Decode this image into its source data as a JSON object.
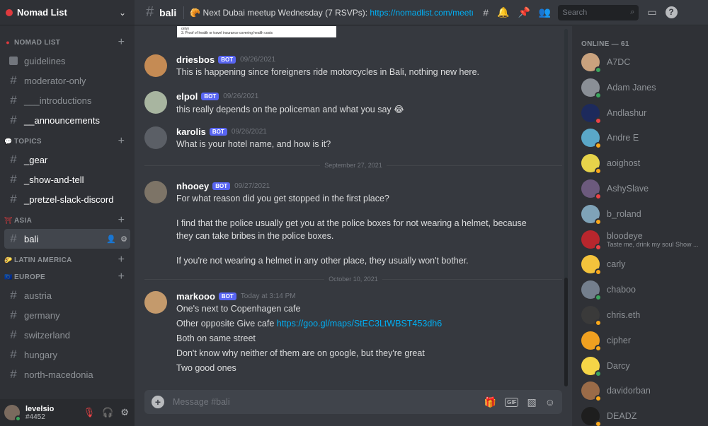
{
  "server": {
    "name": "Nomad List"
  },
  "sidebar": {
    "categories": [
      {
        "label": "NOMAD LIST",
        "channels": [
          {
            "name": "guidelines",
            "kind": "rules"
          },
          {
            "name": "moderator-only",
            "kind": "text"
          },
          {
            "name": "___introductions",
            "kind": "text"
          },
          {
            "name": "__announcements",
            "kind": "text",
            "bold": true
          }
        ]
      },
      {
        "label": "TOPICS",
        "channels": [
          {
            "name": "_gear",
            "kind": "text",
            "bold": true
          },
          {
            "name": "_show-and-tell",
            "kind": "text",
            "bold": true
          },
          {
            "name": "_pretzel-slack-discord",
            "kind": "text",
            "bold": true
          }
        ]
      },
      {
        "label": "ASIA",
        "channels": [
          {
            "name": "bali",
            "kind": "text",
            "active": true
          }
        ]
      },
      {
        "label": "LATIN AMERICA",
        "channels": []
      },
      {
        "label": "EUROPE",
        "channels": [
          {
            "name": "austria",
            "kind": "text"
          },
          {
            "name": "germany",
            "kind": "text"
          },
          {
            "name": "switzerland",
            "kind": "text"
          },
          {
            "name": "hungary",
            "kind": "text"
          },
          {
            "name": "north-macedonia",
            "kind": "text"
          }
        ]
      }
    ]
  },
  "user": {
    "name": "levelsio",
    "tag": "#4452"
  },
  "topbar": {
    "channel": "bali",
    "topic_text": "🥐 Next Dubai meetup Wednesday (7 RSVPs): ",
    "topic_link": "https://nomadlist.com/meetups...",
    "search_placeholder": "Search"
  },
  "preview": {
    "lines": [
      "only)",
      "3. Proof of health or travel insurance  covering health costs"
    ]
  },
  "messages": [
    {
      "author": "driesbos",
      "bot": "BOT",
      "time": "09/26/2021",
      "lines": [
        "This is happening since foreigners ride motorcycles in Bali, nothing new here."
      ]
    },
    {
      "author": "elpol",
      "bot": "BOT",
      "time": "09/26/2021",
      "lines": [
        "this really depends on the policeman and what you say 😂"
      ]
    },
    {
      "author": "karolis",
      "bot": "BOT",
      "time": "09/26/2021",
      "lines": [
        "What is your hotel name, and how is it?"
      ]
    },
    {
      "author": "nhooey",
      "bot": "BOT",
      "time": "09/27/2021",
      "lines": [
        "For what reason did you get stopped in the first place?",
        "",
        "I find that the police usually get you at the police boxes for not wearing a helmet, because",
        "they can take bribes in the police boxes.",
        "",
        "If you're not wearing a helmet in any other place, they usually won't bother."
      ]
    },
    {
      "author": "markooo",
      "bot": "BOT",
      "time": "Today at 3:14 PM",
      "lines": [
        "One's next to Copenhagen cafe",
        "Other opposite Give cafe ",
        "Both on same street",
        "Don't know why neither of them are on google, but they're great",
        "Two good ones"
      ],
      "link": "https://goo.gl/maps/StEC3LtWBST453dh6"
    }
  ],
  "dividers": [
    "September 27, 2021",
    "October 10, 2021"
  ],
  "composer": {
    "placeholder": "Message #bali",
    "gif_label": "GIF"
  },
  "members": {
    "header": "ONLINE — 61",
    "list": [
      {
        "name": "A7DC",
        "status": "online",
        "color": "#c9a27e"
      },
      {
        "name": "Adam Janes",
        "status": "online",
        "color": "#8a8f96"
      },
      {
        "name": "Andlashur",
        "status": "dnd",
        "color": "#1d2a5c"
      },
      {
        "name": "Andre E",
        "status": "idle",
        "color": "#5aa7c8"
      },
      {
        "name": "aoighost",
        "status": "idle",
        "color": "#e6d34a"
      },
      {
        "name": "AshySlave",
        "status": "dnd",
        "color": "#6c5a7d"
      },
      {
        "name": "b_roland",
        "status": "idle",
        "color": "#7fa3b8"
      },
      {
        "name": "bloodeye",
        "status": "dnd",
        "color": "#b8262d",
        "custom": "Taste me, drink my soul Show ..."
      },
      {
        "name": "carly",
        "status": "idle",
        "color": "#f3c33c"
      },
      {
        "name": "chaboo",
        "status": "online",
        "color": "#747f8d"
      },
      {
        "name": "chris.eth",
        "status": "idle",
        "color": "#3a3a3a"
      },
      {
        "name": "cipher",
        "status": "idle",
        "color": "#f0a020"
      },
      {
        "name": "Darcy",
        "status": "online",
        "color": "#f5d547"
      },
      {
        "name": "davidorban",
        "status": "idle",
        "color": "#9a6b48"
      },
      {
        "name": "DEADZ",
        "status": "idle",
        "color": "#1e1e1e"
      }
    ]
  }
}
